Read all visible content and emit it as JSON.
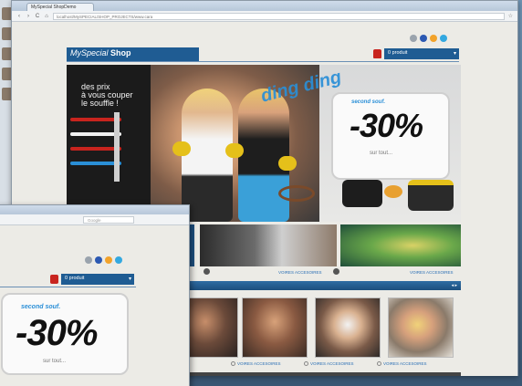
{
  "browser": {
    "tab_title": "MySpecial ShopDemo",
    "url": "localhost/MySPECIAL/SHOP_PROJECTS/www.cara",
    "nav_back": "‹",
    "nav_forward": "›",
    "nav_reload": "C",
    "nav_home": "⌂",
    "star": "☆"
  },
  "site": {
    "brand_light": "MySpecial",
    "brand_bold": "Shop",
    "cart_label": "0 produit",
    "cart_arrow": "▾"
  },
  "social_colors": [
    "#9aa3ad",
    "#2c59b2",
    "#f2a22a",
    "#33a8e0"
  ],
  "hero": {
    "slogan_1": "des prix",
    "slogan_2": "à vous couper",
    "slogan_3": "le souffle !",
    "swoosh": "ding ding",
    "promo_top": "second souf.",
    "promo_value": "-30%",
    "promo_sub": "sur tout..."
  },
  "sub_banners": {
    "label_1": "VOIRES ACCESOIRES",
    "label_2": "VOIRES ACCESOIRES"
  },
  "products": {
    "label": "VOIRES ACCESOIRES"
  },
  "front_window": {
    "search_placeholder": "Google",
    "cart_label": "0 produit",
    "cart_arrow": "▾",
    "promo_top": "second souf.",
    "promo_value": "-30%",
    "promo_sub": "sur tout..."
  }
}
